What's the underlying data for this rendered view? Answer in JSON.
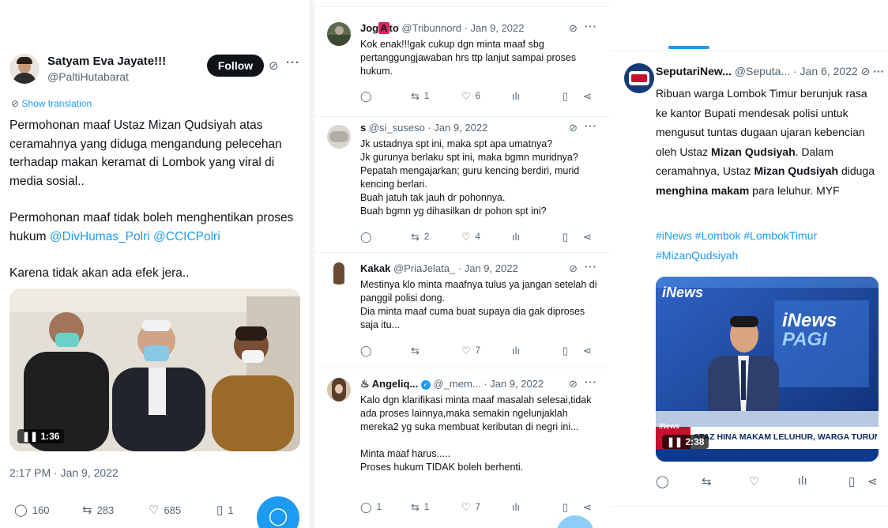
{
  "main_tweet": {
    "author_name": "Satyam Eva Jayate!!!",
    "author_handle": "@PaltiHutabarat",
    "follow_label": "Follow",
    "show_translation": "Show translation",
    "text_line1": "Permohonan maaf Ustaz Mizan Qudsiyah atas ceramahnya yang diduga mengandung pelecehan terhadap makan keramat di Lombok yang viral di media sosial..",
    "text_line2_plain": "Permohonan maaf tidak boleh menghentikan proses hukum ",
    "mention1": "@DivHumas_Polri",
    "mention2": "@CCICPolri",
    "text_line3": "Karena tidak akan ada efek jera..",
    "video_duration": "1:36",
    "timestamp": "2:17 PM · Jan 9, 2022",
    "replies": "160",
    "retweets": "283",
    "likes": "685",
    "bookmarks": "1"
  },
  "replies": [
    {
      "name_a": "Jog",
      "name_box": "A",
      "name_b": "to",
      "handle_date": "@Tribunnord · Jan 9, 2022",
      "text": "Kok enak!!!gak cukup dgn minta maaf sbg pertanggungjawaban hrs ttp lanjut sampai proses hukum.",
      "retweets": "1",
      "likes": "6"
    },
    {
      "name": "s",
      "handle_date": "@si_suseso · Jan 9, 2022",
      "text": "Jk ustadnya spt ini, maka spt apa umatnya?\nJk gurunya berlaku spt ini, maka bgmn muridnya?\nPepatah mengajarkan; guru kencing berdiri, murid kencing berlari.\nBuah jatuh tak jauh dr pohonnya.\nBuah bgmn yg dihasilkan dr pohon spt ini?",
      "retweets": "2",
      "likes": "4"
    },
    {
      "name": "Kakak",
      "handle_date": "@PriaJelata_ · Jan 9, 2022",
      "text": "Mestinya klo minta maafnya tulus ya jangan setelah di panggil polisi dong.\nDia minta maaf cuma buat supaya dia gak diproses saja itu...",
      "likes": "7"
    },
    {
      "name": "♨ Angeliq...",
      "handle_date": "@_mem... · Jan 9, 2022",
      "text": "Kalo dgn klarifikasi minta maaf masalah selesai,tidak ada proses lainnya,maka semakin ngelunjaklah mereka2 yg suka membuat keributan di negri ini...\n\nMinta maaf harus.....\nProses hukum TIDAK boleh berhenti.",
      "replies": "1",
      "retweets": "1",
      "likes": "7"
    }
  ],
  "quoted_tweet": {
    "name": "SeputariNew...",
    "handle_date": "@Seputa... · Jan 6, 2022",
    "text_a": "Ribuan warga Lombok Timur berunjuk rasa ke kantor Bupati mendesak polisi untuk mengusut tuntas dugaan ujaran kebencian oleh Ustaz ",
    "bold1": "Mizan Qudsiyah",
    "text_b": ". Dalam ceramahnya, Ustaz ",
    "bold2": "Mizan Qudsiyah",
    "text_c": " diduga ",
    "bold3": "menghina makam",
    "text_d": " para leluhur. MYF",
    "hashtags": "#iNews #Lombok #LombokTimur #MizanQudsiyah",
    "video_duration": "2:38",
    "logo_small": "iNews",
    "logo_big_1": "iNews",
    "logo_big_2": "PAGI",
    "ticker": "STAZ HINA MAKAM LELUHUR, WARGA TURUN KE JALAN",
    "ticker_tag": "iNews"
  },
  "icons": [
    "grok-icon",
    "more-icon",
    "reply-icon",
    "retweet-icon",
    "like-icon",
    "views-icon",
    "bookmark-icon",
    "share-icon",
    "compose-icon",
    "play-pause-icon"
  ],
  "colors": {
    "accent": "#1d9bf0",
    "text": "#0f1419",
    "muted": "#536471"
  }
}
